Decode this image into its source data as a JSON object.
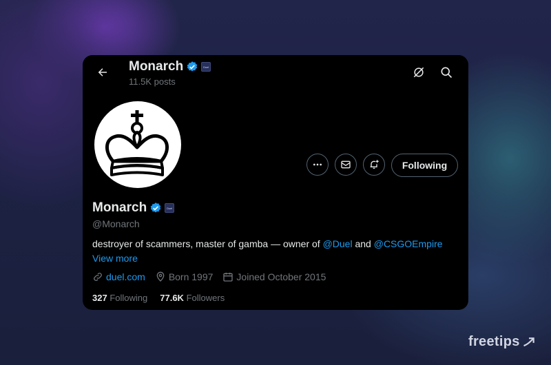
{
  "header": {
    "name": "Monarch",
    "posts": "11.5K posts",
    "badge_text": "Duel"
  },
  "profile": {
    "name": "Monarch",
    "handle": "@Monarch",
    "bio_text": "destroyer of scammers, master of gamba — owner of ",
    "bio_mention1": "@Duel",
    "bio_and": " and ",
    "bio_mention2": "@CSGOEmpire",
    "view_more": "View more",
    "website": "duel.com",
    "born": "Born 1997",
    "joined": "Joined October 2015",
    "following_count": "327",
    "following_label": "Following",
    "followers_count": "77.6K",
    "followers_label": "Followers"
  },
  "actions": {
    "follow_label": "Following"
  },
  "watermark": "freetips",
  "colors": {
    "accent": "#1d9bf0",
    "verified": "#1d9bf0",
    "card_bg": "#000000",
    "muted": "#71767b"
  }
}
